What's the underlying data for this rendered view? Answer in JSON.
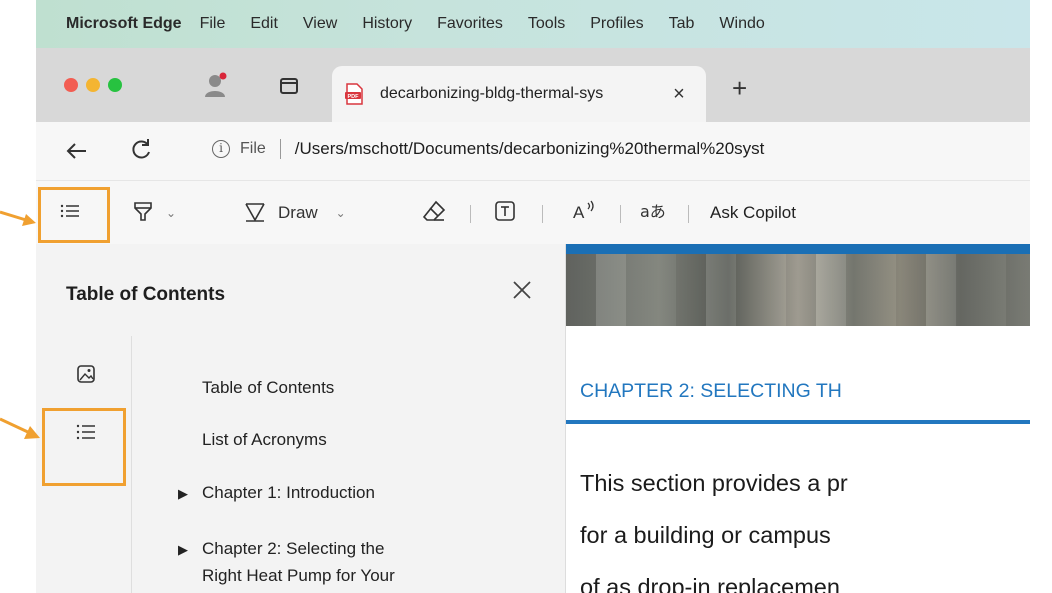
{
  "menubar": {
    "app_name": "Microsoft Edge",
    "items": [
      "File",
      "Edit",
      "View",
      "History",
      "Favorites",
      "Tools",
      "Profiles",
      "Tab",
      "Windo"
    ]
  },
  "tab": {
    "title": "decarbonizing-bldg-thermal-sys",
    "close_label": "×",
    "new_tab_label": "+"
  },
  "address": {
    "info_glyph": "i",
    "file_label": "File",
    "url": "/Users/mschott/Documents/decarbonizing%20thermal%20syst"
  },
  "toolbar": {
    "draw_label": "Draw",
    "ask_copilot_label": "Ask Copilot"
  },
  "sidebar": {
    "title": "Table of Contents",
    "items": [
      {
        "label": "Table of Contents",
        "expandable": false
      },
      {
        "label": "List of Acronyms",
        "expandable": false
      },
      {
        "label": "Chapter 1: Introduction",
        "expandable": true
      },
      {
        "label": "Chapter 2: Selecting the",
        "label_line2": "Right Heat Pump for Your",
        "expandable": true
      }
    ]
  },
  "document": {
    "chapter_heading": "CHAPTER 2: SELECTING TH",
    "body_lines": [
      "This section provides a pr",
      "for a building or campus",
      "of as drop-in replacemen"
    ]
  },
  "colors": {
    "highlight": "#f0a030",
    "doc_accent": "#2277bf"
  }
}
